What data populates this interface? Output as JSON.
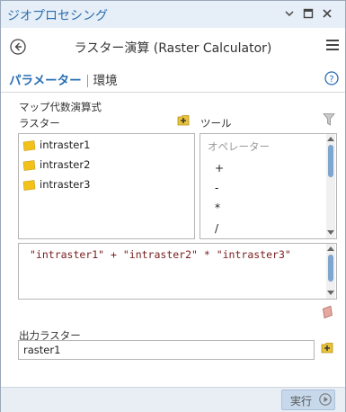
{
  "window": {
    "title": "ジオプロセシング",
    "controls": [
      "chevron-down-icon",
      "restore-icon",
      "close-icon"
    ]
  },
  "header": {
    "tool_title": "ラスター演算 (Raster Calculator)"
  },
  "tabs": {
    "parameters": "パラメーター",
    "environments": "環境"
  },
  "section_label": "マップ代数演算式",
  "raster_list": {
    "label": "ラスター",
    "items": [
      "intraster1",
      "intraster2",
      "intraster3"
    ]
  },
  "tools_list": {
    "label": "ツール",
    "header": "オペレーター",
    "items": [
      "+",
      "-",
      "*",
      "/"
    ]
  },
  "expression": "\"intraster1\" + \"intraster2\" * \"intraster3\"",
  "output": {
    "label": "出力ラスター",
    "value": "raster1"
  },
  "run_button": {
    "label": "実行"
  },
  "colors": {
    "accent": "#2a6fb4",
    "title_text": "#2c6fae",
    "expression_text": "#7a2020",
    "layer_icon": "#f2c21b"
  }
}
